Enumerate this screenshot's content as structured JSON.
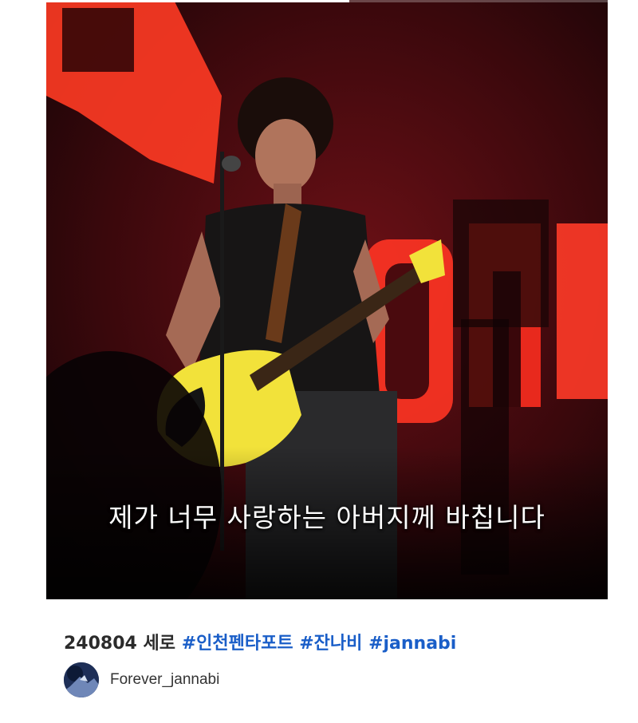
{
  "video": {
    "subtitle": "제가 너무 사랑하는 아버지께 바칩니다",
    "progress": 0.54
  },
  "caption": {
    "date": "240804",
    "label": "세로",
    "hashtags": [
      "#인천펜타포트",
      "#잔나비",
      "#jannabi"
    ]
  },
  "channel": {
    "name": "Forever_jannabi"
  },
  "colors": {
    "hashtag": "#1a5ec8",
    "caption_text": "#2b2b2b",
    "stage_red": "#e8261e"
  }
}
